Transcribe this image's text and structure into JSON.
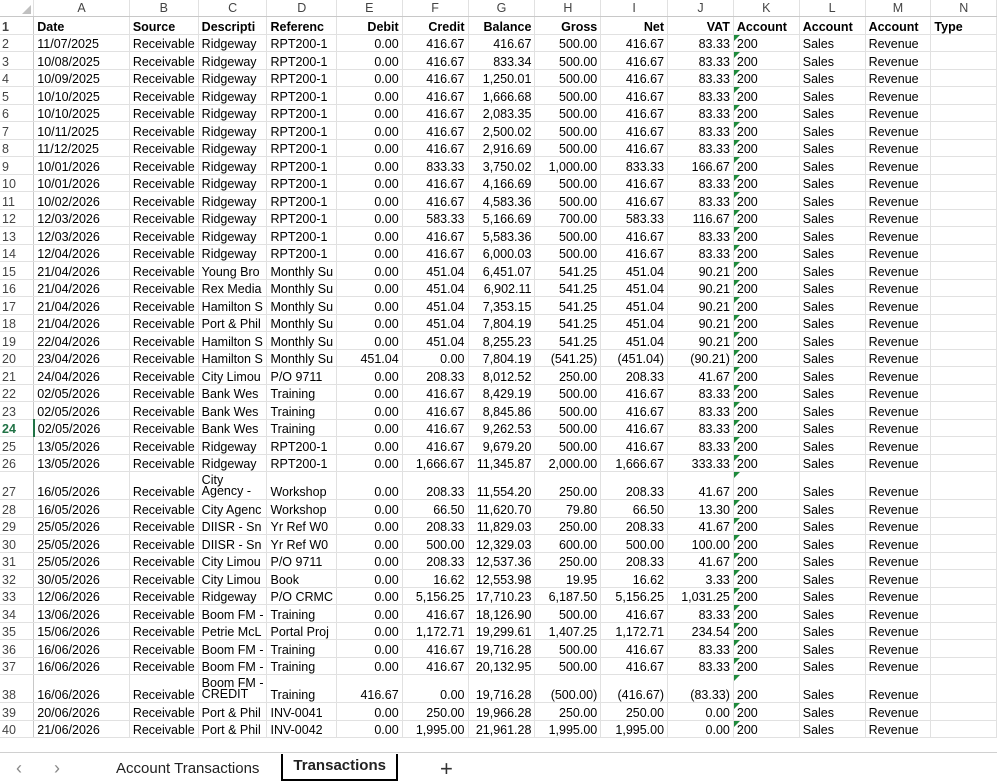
{
  "columns": [
    "A",
    "B",
    "C",
    "D",
    "E",
    "F",
    "G",
    "H",
    "I",
    "J",
    "K",
    "L",
    "M",
    "N"
  ],
  "headers": [
    "Date",
    "Source",
    "Descripti",
    "Referenc",
    "Debit",
    "Credit",
    "Balance",
    "Gross",
    "Net",
    "VAT",
    "Account",
    "Account",
    "Account",
    "Type"
  ],
  "rows": [
    {
      "n": "2",
      "c": [
        "11/07/2025",
        "Receivable",
        "Ridgeway",
        "RPT200-1",
        "0.00",
        "416.67",
        "416.67",
        "500.00",
        "416.67",
        "83.33",
        "200",
        "Sales",
        "Revenue",
        ""
      ]
    },
    {
      "n": "3",
      "c": [
        "10/08/2025",
        "Receivable",
        "Ridgeway",
        "RPT200-1",
        "0.00",
        "416.67",
        "833.34",
        "500.00",
        "416.67",
        "83.33",
        "200",
        "Sales",
        "Revenue",
        ""
      ]
    },
    {
      "n": "4",
      "c": [
        "10/09/2025",
        "Receivable",
        "Ridgeway",
        "RPT200-1",
        "0.00",
        "416.67",
        "1,250.01",
        "500.00",
        "416.67",
        "83.33",
        "200",
        "Sales",
        "Revenue",
        ""
      ]
    },
    {
      "n": "5",
      "c": [
        "10/10/2025",
        "Receivable",
        "Ridgeway",
        "RPT200-1",
        "0.00",
        "416.67",
        "1,666.68",
        "500.00",
        "416.67",
        "83.33",
        "200",
        "Sales",
        "Revenue",
        ""
      ]
    },
    {
      "n": "6",
      "c": [
        "10/10/2025",
        "Receivable",
        "Ridgeway",
        "RPT200-1",
        "0.00",
        "416.67",
        "2,083.35",
        "500.00",
        "416.67",
        "83.33",
        "200",
        "Sales",
        "Revenue",
        ""
      ]
    },
    {
      "n": "7",
      "c": [
        "10/11/2025",
        "Receivable",
        "Ridgeway",
        "RPT200-1",
        "0.00",
        "416.67",
        "2,500.02",
        "500.00",
        "416.67",
        "83.33",
        "200",
        "Sales",
        "Revenue",
        ""
      ]
    },
    {
      "n": "8",
      "c": [
        "11/12/2025",
        "Receivable",
        "Ridgeway",
        "RPT200-1",
        "0.00",
        "416.67",
        "2,916.69",
        "500.00",
        "416.67",
        "83.33",
        "200",
        "Sales",
        "Revenue",
        ""
      ]
    },
    {
      "n": "9",
      "c": [
        "10/01/2026",
        "Receivable",
        "Ridgeway",
        "RPT200-1",
        "0.00",
        "833.33",
        "3,750.02",
        "1,000.00",
        "833.33",
        "166.67",
        "200",
        "Sales",
        "Revenue",
        ""
      ]
    },
    {
      "n": "10",
      "c": [
        "10/01/2026",
        "Receivable",
        "Ridgeway",
        "RPT200-1",
        "0.00",
        "416.67",
        "4,166.69",
        "500.00",
        "416.67",
        "83.33",
        "200",
        "Sales",
        "Revenue",
        ""
      ]
    },
    {
      "n": "11",
      "c": [
        "10/02/2026",
        "Receivable",
        "Ridgeway",
        "RPT200-1",
        "0.00",
        "416.67",
        "4,583.36",
        "500.00",
        "416.67",
        "83.33",
        "200",
        "Sales",
        "Revenue",
        ""
      ]
    },
    {
      "n": "12",
      "c": [
        "12/03/2026",
        "Receivable",
        "Ridgeway",
        "RPT200-1",
        "0.00",
        "583.33",
        "5,166.69",
        "700.00",
        "583.33",
        "116.67",
        "200",
        "Sales",
        "Revenue",
        ""
      ]
    },
    {
      "n": "13",
      "c": [
        "12/03/2026",
        "Receivable",
        "Ridgeway",
        "RPT200-1",
        "0.00",
        "416.67",
        "5,583.36",
        "500.00",
        "416.67",
        "83.33",
        "200",
        "Sales",
        "Revenue",
        ""
      ]
    },
    {
      "n": "14",
      "c": [
        "12/04/2026",
        "Receivable",
        "Ridgeway",
        "RPT200-1",
        "0.00",
        "416.67",
        "6,000.03",
        "500.00",
        "416.67",
        "83.33",
        "200",
        "Sales",
        "Revenue",
        ""
      ]
    },
    {
      "n": "15",
      "c": [
        "21/04/2026",
        "Receivable",
        "Young Bro",
        "Monthly Su",
        "0.00",
        "451.04",
        "6,451.07",
        "541.25",
        "451.04",
        "90.21",
        "200",
        "Sales",
        "Revenue",
        ""
      ]
    },
    {
      "n": "16",
      "c": [
        "21/04/2026",
        "Receivable",
        "Rex Media",
        "Monthly Su",
        "0.00",
        "451.04",
        "6,902.11",
        "541.25",
        "451.04",
        "90.21",
        "200",
        "Sales",
        "Revenue",
        ""
      ]
    },
    {
      "n": "17",
      "c": [
        "21/04/2026",
        "Receivable",
        "Hamilton S",
        "Monthly Su",
        "0.00",
        "451.04",
        "7,353.15",
        "541.25",
        "451.04",
        "90.21",
        "200",
        "Sales",
        "Revenue",
        ""
      ]
    },
    {
      "n": "18",
      "c": [
        "21/04/2026",
        "Receivable",
        "Port & Phil",
        "Monthly Su",
        "0.00",
        "451.04",
        "7,804.19",
        "541.25",
        "451.04",
        "90.21",
        "200",
        "Sales",
        "Revenue",
        ""
      ]
    },
    {
      "n": "19",
      "c": [
        "22/04/2026",
        "Receivable",
        "Hamilton S",
        "Monthly Su",
        "0.00",
        "451.04",
        "8,255.23",
        "541.25",
        "451.04",
        "90.21",
        "200",
        "Sales",
        "Revenue",
        ""
      ]
    },
    {
      "n": "20",
      "c": [
        "23/04/2026",
        "Receivable",
        "Hamilton S",
        "Monthly Su",
        "451.04",
        "0.00",
        "7,804.19",
        "(541.25)",
        "(451.04)",
        "(90.21)",
        "200",
        "Sales",
        "Revenue",
        ""
      ]
    },
    {
      "n": "21",
      "c": [
        "24/04/2026",
        "Receivable",
        "City Limou",
        "P/O 9711",
        "0.00",
        "208.33",
        "8,012.52",
        "250.00",
        "208.33",
        "41.67",
        "200",
        "Sales",
        "Revenue",
        ""
      ]
    },
    {
      "n": "22",
      "c": [
        "02/05/2026",
        "Receivable",
        "Bank Wes",
        "Training",
        "0.00",
        "416.67",
        "8,429.19",
        "500.00",
        "416.67",
        "83.33",
        "200",
        "Sales",
        "Revenue",
        ""
      ]
    },
    {
      "n": "23",
      "c": [
        "02/05/2026",
        "Receivable",
        "Bank Wes",
        "Training",
        "0.00",
        "416.67",
        "8,845.86",
        "500.00",
        "416.67",
        "83.33",
        "200",
        "Sales",
        "Revenue",
        ""
      ]
    },
    {
      "n": "24",
      "c": [
        "02/05/2026",
        "Receivable",
        "Bank Wes",
        "Training",
        "0.00",
        "416.67",
        "9,262.53",
        "500.00",
        "416.67",
        "83.33",
        "200",
        "Sales",
        "Revenue",
        ""
      ]
    },
    {
      "n": "25",
      "c": [
        "13/05/2026",
        "Receivable",
        "Ridgeway",
        "RPT200-1",
        "0.00",
        "416.67",
        "9,679.20",
        "500.00",
        "416.67",
        "83.33",
        "200",
        "Sales",
        "Revenue",
        ""
      ]
    },
    {
      "n": "26",
      "c": [
        "13/05/2026",
        "Receivable",
        "Ridgeway",
        "RPT200-1",
        "0.00",
        "1,666.67",
        "11,345.87",
        "2,000.00",
        "1,666.67",
        "333.33",
        "200",
        "Sales",
        "Revenue",
        ""
      ]
    },
    {
      "n": "27",
      "c": [
        "16/05/2026",
        "Receivable",
        "City Agency -",
        "Workshop",
        "0.00",
        "208.33",
        "11,554.20",
        "250.00",
        "208.33",
        "41.67",
        "200",
        "Sales",
        "Revenue",
        ""
      ]
    },
    {
      "n": "28",
      "c": [
        "16/05/2026",
        "Receivable",
        "City Agenc",
        "Workshop",
        "0.00",
        "66.50",
        "11,620.70",
        "79.80",
        "66.50",
        "13.30",
        "200",
        "Sales",
        "Revenue",
        ""
      ]
    },
    {
      "n": "29",
      "c": [
        "25/05/2026",
        "Receivable",
        "DIISR - Sn",
        "Yr Ref W0",
        "0.00",
        "208.33",
        "11,829.03",
        "250.00",
        "208.33",
        "41.67",
        "200",
        "Sales",
        "Revenue",
        ""
      ]
    },
    {
      "n": "30",
      "c": [
        "25/05/2026",
        "Receivable",
        "DIISR - Sn",
        "Yr Ref W0",
        "0.00",
        "500.00",
        "12,329.03",
        "600.00",
        "500.00",
        "100.00",
        "200",
        "Sales",
        "Revenue",
        ""
      ]
    },
    {
      "n": "31",
      "c": [
        "25/05/2026",
        "Receivable",
        "City Limou",
        "P/O 9711",
        "0.00",
        "208.33",
        "12,537.36",
        "250.00",
        "208.33",
        "41.67",
        "200",
        "Sales",
        "Revenue",
        ""
      ]
    },
    {
      "n": "32",
      "c": [
        "30/05/2026",
        "Receivable",
        "City Limou",
        "Book",
        "0.00",
        "16.62",
        "12,553.98",
        "19.95",
        "16.62",
        "3.33",
        "200",
        "Sales",
        "Revenue",
        ""
      ]
    },
    {
      "n": "33",
      "c": [
        "12/06/2026",
        "Receivable",
        "Ridgeway",
        "P/O CRMC",
        "0.00",
        "5,156.25",
        "17,710.23",
        "6,187.50",
        "5,156.25",
        "1,031.25",
        "200",
        "Sales",
        "Revenue",
        ""
      ]
    },
    {
      "n": "34",
      "c": [
        "13/06/2026",
        "Receivable",
        "Boom FM -",
        "Training",
        "0.00",
        "416.67",
        "18,126.90",
        "500.00",
        "416.67",
        "83.33",
        "200",
        "Sales",
        "Revenue",
        ""
      ]
    },
    {
      "n": "35",
      "c": [
        "15/06/2026",
        "Receivable",
        "Petrie McL",
        "Portal Proj",
        "0.00",
        "1,172.71",
        "19,299.61",
        "1,407.25",
        "1,172.71",
        "234.54",
        "200",
        "Sales",
        "Revenue",
        ""
      ]
    },
    {
      "n": "36",
      "c": [
        "16/06/2026",
        "Receivable",
        "Boom FM -",
        "Training",
        "0.00",
        "416.67",
        "19,716.28",
        "500.00",
        "416.67",
        "83.33",
        "200",
        "Sales",
        "Revenue",
        ""
      ]
    },
    {
      "n": "37",
      "c": [
        "16/06/2026",
        "Receivable",
        "Boom FM -",
        "Training",
        "0.00",
        "416.67",
        "20,132.95",
        "500.00",
        "416.67",
        "83.33",
        "200",
        "Sales",
        "Revenue",
        ""
      ]
    },
    {
      "n": "38",
      "c": [
        "16/06/2026",
        "Receivable",
        "Boom FM - CREDIT",
        "Training",
        "416.67",
        "0.00",
        "19,716.28",
        "(500.00)",
        "(416.67)",
        "(83.33)",
        "200",
        "Sales",
        "Revenue",
        ""
      ]
    },
    {
      "n": "39",
      "c": [
        "20/06/2026",
        "Receivable",
        "Port & Phil",
        "INV-0041",
        "0.00",
        "250.00",
        "19,966.28",
        "250.00",
        "250.00",
        "0.00",
        "200",
        "Sales",
        "Revenue",
        ""
      ]
    },
    {
      "n": "40",
      "c": [
        "21/06/2026",
        "Receivable",
        "Port & Phil",
        "INV-0042",
        "0.00",
        "1,995.00",
        "21,961.28",
        "1,995.00",
        "1,995.00",
        "0.00",
        "200",
        "Sales",
        "Revenue",
        ""
      ]
    }
  ],
  "tabs": {
    "prev_icon": "chevron-left-icon",
    "next_icon": "chevron-right-icon",
    "sheet1": "Account Transactions",
    "sheet2": "Transactions",
    "add_icon": "plus-icon"
  },
  "colors": {
    "accent": "#217346",
    "error_marker": "#1e8a3c",
    "grid": "#e1e1e1"
  }
}
